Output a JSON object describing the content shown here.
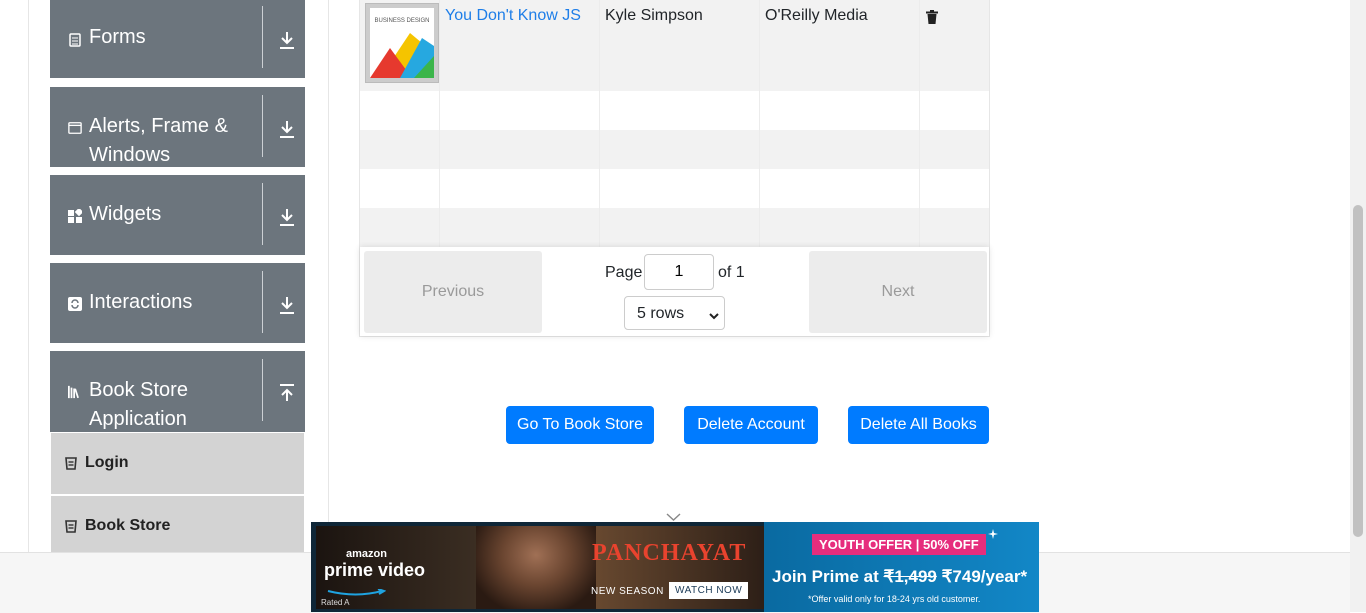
{
  "sidebar": {
    "groups": [
      {
        "label": "Forms"
      },
      {
        "label": "Alerts, Frame &"
      },
      {
        "label": "Widgets"
      },
      {
        "label": "Interactions"
      },
      {
        "label": "Book Store"
      }
    ],
    "groups_line2": {
      "alerts": "Windows",
      "bookstore": "Application"
    },
    "items": [
      {
        "label": "Login"
      },
      {
        "label": "Book Store"
      }
    ]
  },
  "table": {
    "rows": [
      {
        "title": "You Don't Know JS",
        "author": "Kyle Simpson",
        "publisher": "O'Reilly Media"
      }
    ],
    "cover_text": "BUSINESS DESIGN"
  },
  "pagination": {
    "previous": "Previous",
    "next": "Next",
    "page_label": "Page",
    "page_value": "1",
    "of_label": "of 1",
    "rows_option": "5 rows"
  },
  "actions": {
    "go_to_store": "Go To Book Store",
    "delete_account": "Delete Account",
    "delete_all": "Delete All Books"
  },
  "ad": {
    "brand_top": "amazon",
    "brand": "prime video",
    "rating": "Rated A",
    "show_title": "PANCHAYAT",
    "new_season": "NEW SEASON",
    "watch_now": "WATCH NOW",
    "offer_badge": "YOUTH OFFER | 50% OFF",
    "join_text": "Join Prime at",
    "old_price": "₹1,499",
    "new_price": "₹749/year*",
    "disclaimer": "*Offer valid only for 18-24 yrs old customer."
  },
  "colors": {
    "sidebar_group": "#6c757d",
    "menu_item": "#d3d3d3",
    "primary": "#007bff",
    "link": "#1e7ee8"
  }
}
